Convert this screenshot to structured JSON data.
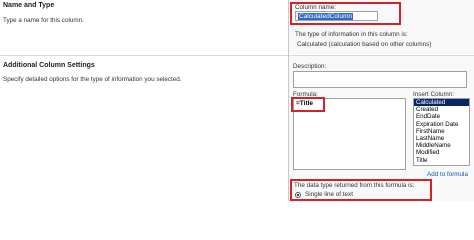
{
  "name_section": {
    "title": "Name and Type",
    "description": "Type a name for this column.",
    "column_name_label": "Column name:",
    "column_name_value": "CalculatedColumn",
    "type_info_label": "The type of information in this column is:",
    "type_value": "Calculated (calculation based on other columns)"
  },
  "settings_section": {
    "title": "Additional Column Settings",
    "description": "Specify detailed options for the type of information you selected.",
    "description_label": "Description:",
    "formula_label": "Formula:",
    "formula_value": "=Title",
    "insert_column_label": "Insert Column:",
    "columns": [
      "Calculated",
      "Created",
      "EndDate",
      "Expiration Date",
      "FirstName",
      "LastName",
      "MiddleName",
      "Modified",
      "Title"
    ],
    "selected_column": "Calculated",
    "add_to_formula": "Add to formula",
    "return_type_label": "The data type returned from this formula is:",
    "return_type_option": "Single line of text"
  },
  "colors": {
    "highlight": "#d6202a",
    "link": "#1a55b5",
    "selection": "#0a246a"
  }
}
